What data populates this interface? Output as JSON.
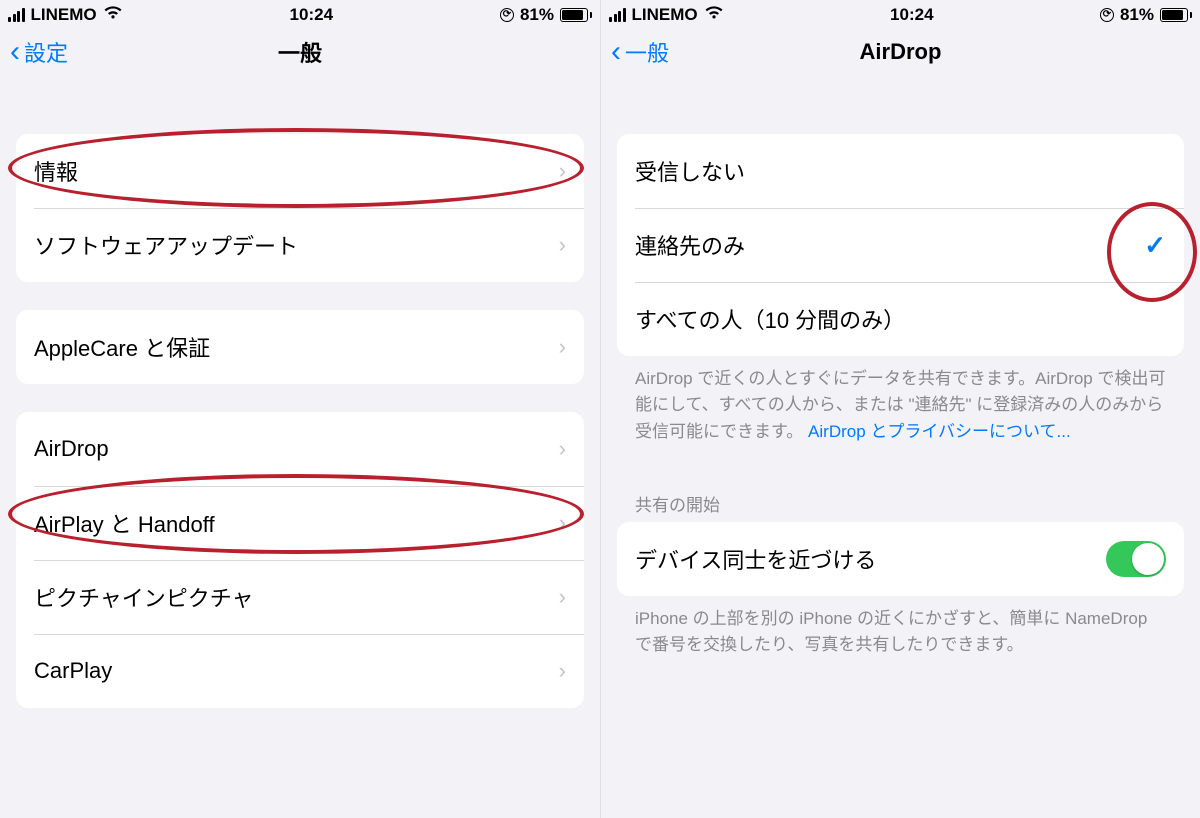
{
  "status": {
    "carrier": "LINEMO",
    "time": "10:24",
    "battery_pct": "81%"
  },
  "left": {
    "back": "設定",
    "title": "一般",
    "group1": [
      {
        "label": "情報"
      },
      {
        "label": "ソフトウェアアップデート"
      }
    ],
    "group2": [
      {
        "label": "AppleCare と保証"
      }
    ],
    "group3": [
      {
        "label": "AirDrop"
      },
      {
        "label": "AirPlay と Handoff"
      },
      {
        "label": "ピクチャインピクチャ"
      },
      {
        "label": "CarPlay"
      }
    ]
  },
  "right": {
    "back": "一般",
    "title": "AirDrop",
    "options": [
      {
        "label": "受信しない",
        "selected": false
      },
      {
        "label": "連絡先のみ",
        "selected": true
      },
      {
        "label": "すべての人（10 分間のみ）",
        "selected": false
      }
    ],
    "footer_text": "AirDrop で近くの人とすぐにデータを共有できます。AirDrop で検出可能にして、すべての人から、または \"連絡先\" に登録済みの人のみから受信可能にできます。",
    "footer_link": "AirDrop とプライバシーについて...",
    "section_header": "共有の開始",
    "toggle_row": {
      "label": "デバイス同士を近づける",
      "on": true
    },
    "footer2": "iPhone の上部を別の iPhone の近くにかざすと、簡単に NameDrop で番号を交換したり、写真を共有したりできます。"
  },
  "annotations": {
    "ellipses": [
      "row-info",
      "row-airdrop",
      "option-check"
    ]
  }
}
